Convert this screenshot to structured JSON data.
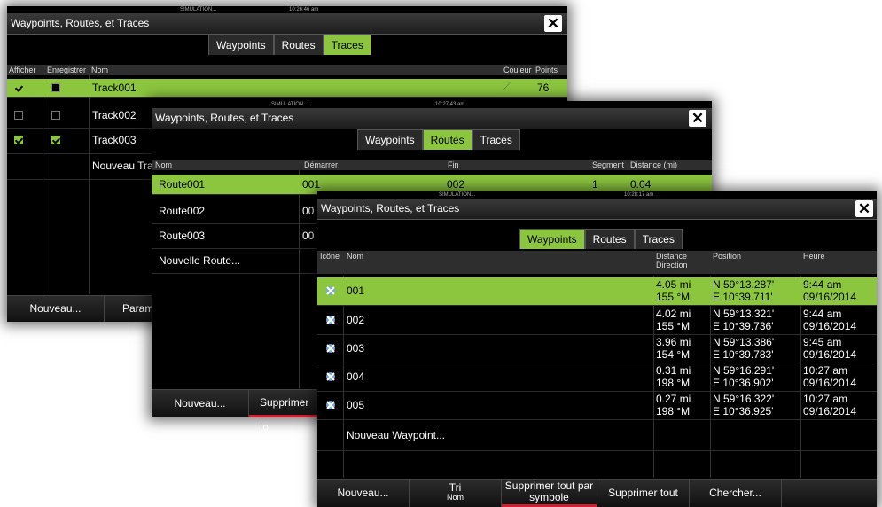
{
  "dialog1": {
    "status_left": "SIMULATION...",
    "status_time": "10:26:46 am",
    "title": "Waypoints, Routes, et Traces",
    "tabs": [
      "Waypoints",
      "Routes",
      "Traces"
    ],
    "active_tab": "Traces",
    "headers": {
      "show": "Afficher",
      "record": "Enregistrer",
      "name": "Nom",
      "color": "Couleur",
      "points": "Points"
    },
    "rows": [
      {
        "name": "Track001",
        "show": true,
        "record": "black",
        "points": "76",
        "selected": true
      },
      {
        "name": "Track002",
        "show": false,
        "record": "off",
        "points": "",
        "selected": false
      },
      {
        "name": "Track003",
        "show": true,
        "record": "on",
        "points": "",
        "selected": false
      },
      {
        "name": "Nouveau Trac",
        "show": null,
        "record": null,
        "points": "",
        "selected": false
      }
    ],
    "bottom": [
      "Nouveau...",
      "Param"
    ]
  },
  "dialog2": {
    "status_left": "SIMULATION...",
    "status_time": "10:27:43 am",
    "title": "Waypoints, Routes, et Traces",
    "tabs": [
      "Waypoints",
      "Routes",
      "Traces"
    ],
    "active_tab": "Routes",
    "headers": {
      "name": "Nom",
      "start": "Démarrer",
      "end": "Fin",
      "segment": "Segment",
      "distance": "Distance (mi)"
    },
    "rows": [
      {
        "name": "Route001",
        "start": "001",
        "end": "002",
        "segment": "1",
        "distance": "0.04",
        "selected": true
      },
      {
        "name": "Route002",
        "start": "00",
        "selected": false
      },
      {
        "name": "Route003",
        "start": "00",
        "selected": false
      },
      {
        "name": "Nouvelle Route...",
        "start": "",
        "selected": false
      }
    ],
    "bottom": [
      "Nouveau...",
      "Supprimer to"
    ]
  },
  "dialog3": {
    "status_left": "SIMULATION...",
    "status_time": "10:28:17 am",
    "title": "Waypoints, Routes, et Traces",
    "tabs": [
      "Waypoints",
      "Routes",
      "Traces"
    ],
    "active_tab": "Waypoints",
    "headers": {
      "icon": "Icône",
      "name": "Nom",
      "distance": "Distance",
      "direction": "Direction",
      "position": "Position",
      "time": "Heure"
    },
    "rows": [
      {
        "name": "001",
        "dist": "4.05 mi",
        "dir": "155 °M",
        "lat": "N  59°13.287'",
        "lon": "E  10°39.711'",
        "time": "9:44 am",
        "date": "09/16/2014",
        "selected": true
      },
      {
        "name": "002",
        "dist": "4.02 mi",
        "dir": "155 °M",
        "lat": "N  59°13.321'",
        "lon": "E  10°39.736'",
        "time": "9:44 am",
        "date": "09/16/2014",
        "selected": false
      },
      {
        "name": "003",
        "dist": "3.96 mi",
        "dir": "154 °M",
        "lat": "N  59°13.386'",
        "lon": "E  10°39.783'",
        "time": "9:45 am",
        "date": "09/16/2014",
        "selected": false
      },
      {
        "name": "004",
        "dist": "0.31 mi",
        "dir": "198 °M",
        "lat": "N  59°16.291'",
        "lon": "E  10°36.902'",
        "time": "10:27 am",
        "date": "09/16/2014",
        "selected": false
      },
      {
        "name": "005",
        "dist": "0.27 mi",
        "dir": "198 °M",
        "lat": "N  59°16.322'",
        "lon": "E  10°36.925'",
        "time": "10:27 am",
        "date": "09/16/2014",
        "selected": false
      }
    ],
    "new_waypoint": "Nouveau Waypoint...",
    "bottom": {
      "new": "Nouveau...",
      "sort": "Tri",
      "sort_sub": "Nom",
      "delete_by_symbol_1": "Supprimer tout par",
      "delete_by_symbol_2": "symbole",
      "delete_all": "Supprimer tout",
      "search": "Chercher..."
    }
  },
  "colors": {
    "accent": "#8cc63f",
    "red_underline": "#d01f2f",
    "waypoint_icon": "#7aa7d8"
  },
  "icons": {
    "close": "close-icon",
    "waypoint": "waypoint-marker-icon",
    "track_color": "track-color-icon"
  }
}
